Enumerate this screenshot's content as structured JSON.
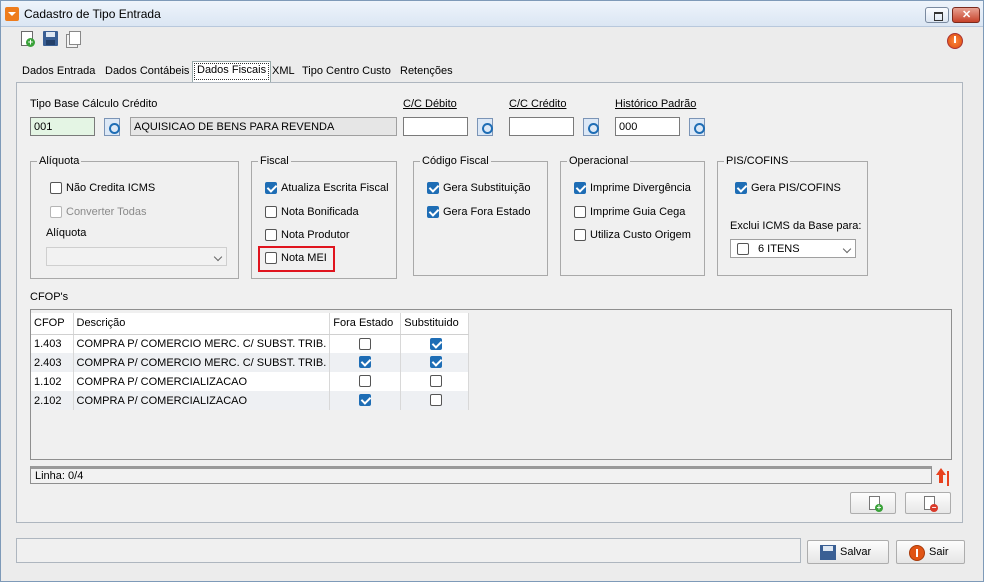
{
  "window": {
    "title": "Cadastro de Tipo Entrada"
  },
  "toolbar": {
    "icons": [
      "new-document-icon",
      "save-icon",
      "copy-icon",
      "power-icon"
    ]
  },
  "tabs": [
    "Dados Entrada",
    "Dados Contábeis",
    "Dados Fiscais",
    "XML",
    "Tipo Centro Custo",
    "Retenções"
  ],
  "active_tab": "Dados Fiscais",
  "fields": {
    "tipo_base_label": "Tipo Base Cálculo Crédito",
    "tipo_base_code": "001",
    "tipo_base_desc": "AQUISICAO DE BENS PARA REVENDA",
    "cc_debito_label": "C/C Débito",
    "cc_debito_value": "",
    "cc_credito_label": "C/C Crédito",
    "cc_credito_value": "",
    "historico_label": "Histórico Padrão",
    "historico_value": "000"
  },
  "groups": {
    "aliquota": {
      "title": "Alíquota",
      "nao_credita": "Não Credita ICMS",
      "converter": "Converter Todas",
      "aliquota_label": "Alíquota",
      "aliquota_value": ""
    },
    "fiscal": {
      "title": "Fiscal",
      "atualiza": "Atualiza Escrita Fiscal",
      "bonificada": "Nota Bonificada",
      "produtor": "Nota Produtor",
      "mei": "Nota MEI"
    },
    "codigo": {
      "title": "Código Fiscal",
      "substituicao": "Gera Substituição",
      "fora_estado": "Gera Fora Estado"
    },
    "operacional": {
      "title": "Operacional",
      "divergencia": "Imprime Divergência",
      "guia_cega": "Imprime Guia Cega",
      "custo_origem": "Utiliza Custo Origem"
    },
    "pis": {
      "title": "PIS/COFINS",
      "gera": "Gera PIS/COFINS",
      "exclui_label": "Exclui ICMS da Base para:",
      "exclui_value": "6 ITENS"
    }
  },
  "cfops": {
    "title": "CFOP's",
    "columns": [
      "CFOP",
      "Descrição",
      "Fora Estado",
      "Substituido"
    ],
    "rows": [
      {
        "cfop": "1.403",
        "descricao": "COMPRA P/ COMERCIO MERC. C/ SUBST. TRIB.",
        "fora_estado": false,
        "substituido": true
      },
      {
        "cfop": "2.403",
        "descricao": "COMPRA P/ COMERCIO MERC. C/ SUBST. TRIB.",
        "fora_estado": true,
        "substituido": true
      },
      {
        "cfop": "1.102",
        "descricao": "COMPRA P/ COMERCIALIZACAO",
        "fora_estado": false,
        "substituido": false
      },
      {
        "cfop": "2.102",
        "descricao": "COMPRA P/ COMERCIALIZACAO",
        "fora_estado": true,
        "substituido": false
      }
    ],
    "status": "Linha: 0/4"
  },
  "buttons": {
    "salvar": "Salvar",
    "sair": "Sair"
  }
}
